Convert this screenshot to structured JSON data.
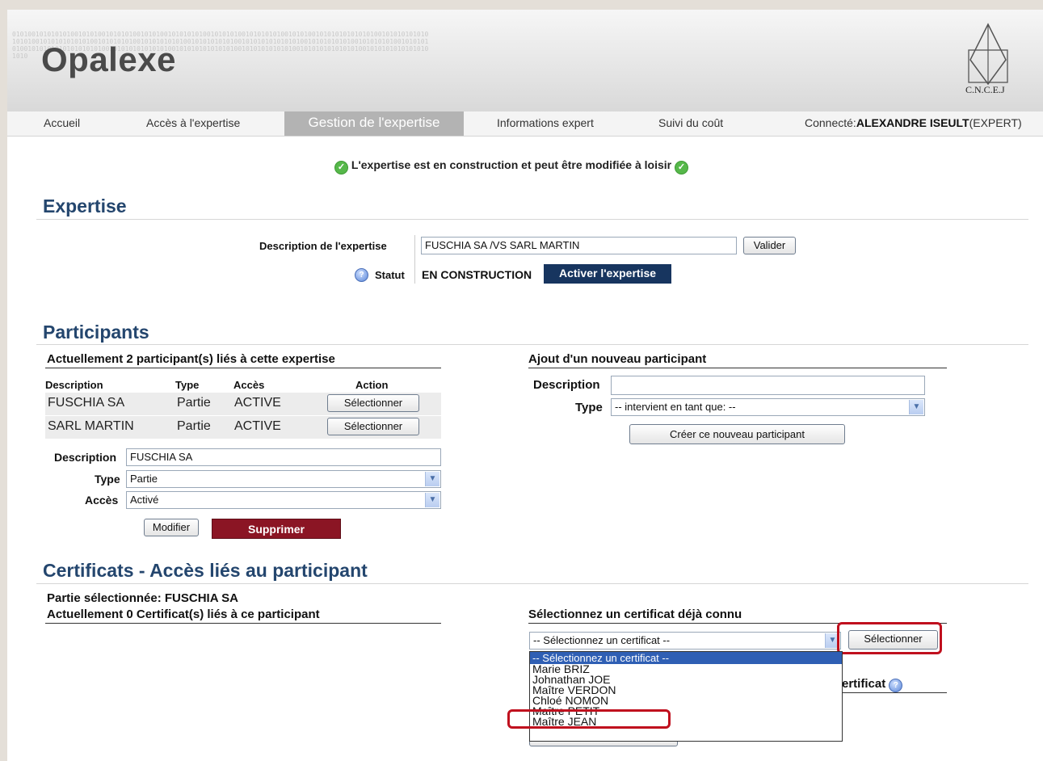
{
  "header": {
    "app_title": "Opalexe",
    "logo_label": "C.N.C.E.J",
    "binary_texture": "0101001010101010010101001010101001010100101010101001010101001010101010010101001010101010101010010101010101010101001010101010101001010101010010101010101001010101010100101010101010101001010101010100101010101001010101010010101010101010101010010101010101010100101010101010101001010101010101001010101010101010010101010101010101010"
  },
  "nav": {
    "items": [
      "Accueil",
      "Accès à l'expertise",
      "Gestion de l'expertise",
      "Informations expert",
      "Suivi du coût"
    ],
    "active": "Gestion de l'expertise",
    "connected_label": "Connecté:",
    "connected_user": "ALEXANDRE ISEULT",
    "connected_role": "(EXPERT)"
  },
  "status_message": "L'expertise est en construction et peut être modifiée à loisir",
  "expertise": {
    "title": "Expertise",
    "description_label": "Description de l'expertise",
    "description_value": "FUSCHIA SA /VS SARL MARTIN",
    "validate_button": "Valider",
    "status_label": "Statut",
    "status_value": "EN CONSTRUCTION",
    "activate_button": "Activer l'expertise"
  },
  "participants": {
    "title": "Participants",
    "current_heading": "Actuellement 2 participant(s) liés à cette expertise",
    "columns": [
      "Description",
      "Type",
      "Accès",
      "Action"
    ],
    "rows": [
      {
        "description": "FUSCHIA SA",
        "type": "Partie",
        "access": "ACTIVE",
        "action": "Sélectionner"
      },
      {
        "description": "SARL MARTIN",
        "type": "Partie",
        "access": "ACTIVE",
        "action": "Sélectionner"
      }
    ],
    "edit": {
      "description_label": "Description",
      "description_value": "FUSCHIA SA",
      "type_label": "Type",
      "type_value": "Partie",
      "access_label": "Accès",
      "access_value": "Activé",
      "modify_button": "Modifier",
      "delete_button": "Supprimer"
    },
    "new": {
      "heading": "Ajout d'un nouveau participant",
      "description_label": "Description",
      "description_value": "",
      "type_label": "Type",
      "type_value": "-- intervient en tant que: --",
      "create_button": "Créer ce nouveau participant"
    }
  },
  "certificates": {
    "title": "Certificats - Accès liés au participant",
    "selected_party": "Partie sélectionnée: FUSCHIA SA",
    "current_count": "Actuellement 0 Certificat(s) liés à ce participant",
    "select_heading": "Sélectionnez un certificat déjà connu",
    "select_value": "-- Sélectionnez un certificat --",
    "select_button": "Sélectionner",
    "options": [
      "-- Sélectionnez un certificat --",
      "Marie BRIZ",
      "Johnathan JOE",
      "Maître VERDON",
      "Chloé NOMON",
      "Maître PETIT",
      "Maître JEAN"
    ],
    "highlighted_option": "Maître PETIT",
    "partial_heading": "ertificat"
  },
  "colors": {
    "section_title": "#24466e",
    "activate_button": "#17355f",
    "delete_button": "#8b1524",
    "highlight_box": "#c0101e",
    "dropdown_selected": "#2f5fb4"
  }
}
